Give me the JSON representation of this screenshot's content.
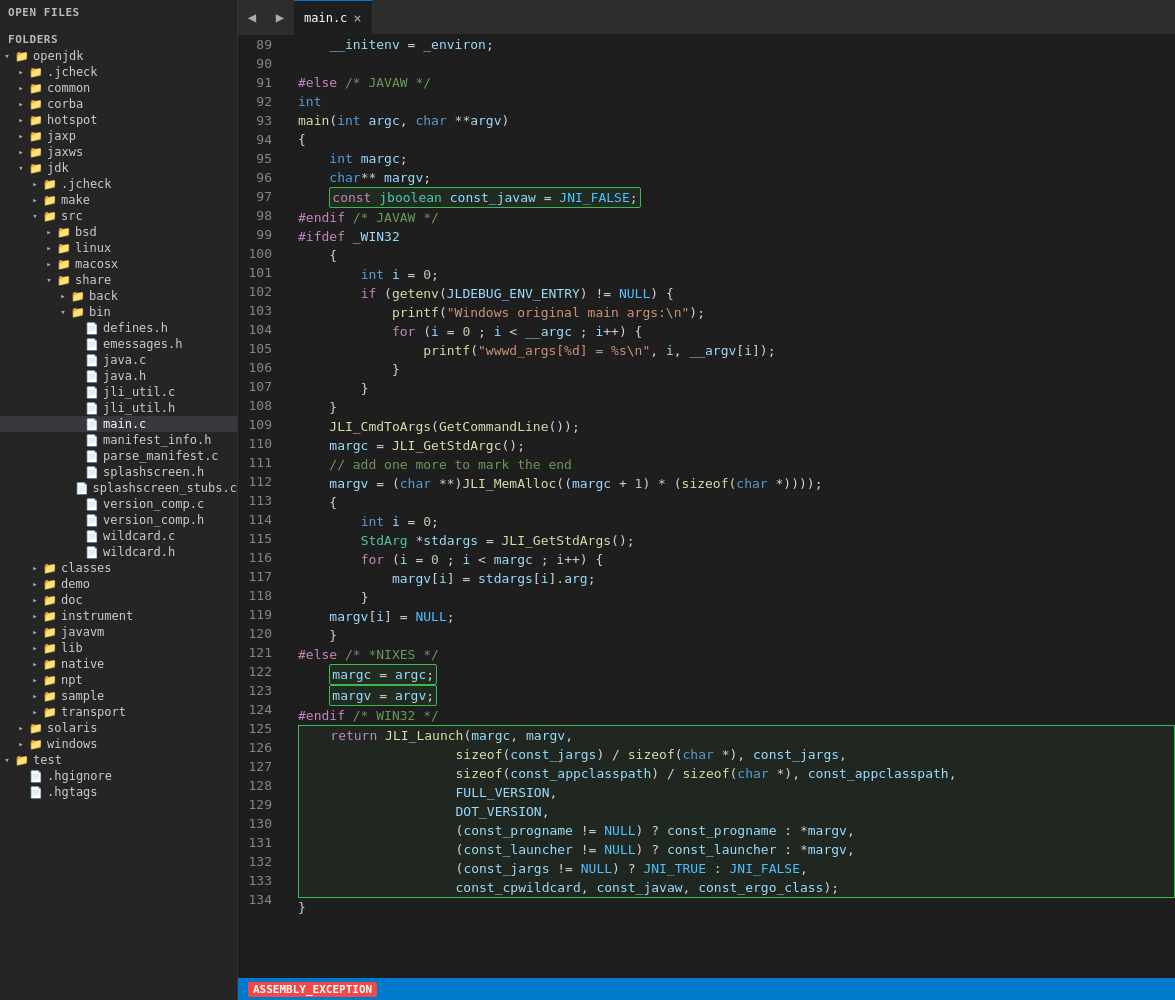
{
  "sidebar": {
    "open_files_label": "OPEN FILES",
    "folders_label": "FOLDERS",
    "tree": [
      {
        "id": "openjdk",
        "label": "openjdk",
        "type": "folder",
        "expanded": true,
        "depth": 0
      },
      {
        "id": "jcheck",
        "label": ".jcheck",
        "type": "folder",
        "expanded": false,
        "depth": 1
      },
      {
        "id": "common",
        "label": "common",
        "type": "folder",
        "expanded": false,
        "depth": 1
      },
      {
        "id": "corba",
        "label": "corba",
        "type": "folder",
        "expanded": false,
        "depth": 1
      },
      {
        "id": "hotspot",
        "label": "hotspot",
        "type": "folder",
        "expanded": false,
        "depth": 1
      },
      {
        "id": "jaxp",
        "label": "jaxp",
        "type": "folder",
        "expanded": false,
        "depth": 1
      },
      {
        "id": "jaxws",
        "label": "jaxws",
        "type": "folder",
        "expanded": false,
        "depth": 1
      },
      {
        "id": "jdk",
        "label": "jdk",
        "type": "folder",
        "expanded": true,
        "depth": 1
      },
      {
        "id": "jdk-jcheck",
        "label": ".jcheck",
        "type": "folder",
        "expanded": false,
        "depth": 2
      },
      {
        "id": "make",
        "label": "make",
        "type": "folder",
        "expanded": false,
        "depth": 2
      },
      {
        "id": "src",
        "label": "src",
        "type": "folder",
        "expanded": true,
        "depth": 2
      },
      {
        "id": "bsd",
        "label": "bsd",
        "type": "folder",
        "expanded": false,
        "depth": 3
      },
      {
        "id": "linux",
        "label": "linux",
        "type": "folder",
        "expanded": false,
        "depth": 3
      },
      {
        "id": "macosx",
        "label": "macosx",
        "type": "folder",
        "expanded": false,
        "depth": 3
      },
      {
        "id": "share",
        "label": "share",
        "type": "folder",
        "expanded": true,
        "depth": 3
      },
      {
        "id": "back",
        "label": "back",
        "type": "folder",
        "expanded": false,
        "depth": 4
      },
      {
        "id": "bin",
        "label": "bin",
        "type": "folder",
        "expanded": true,
        "depth": 4
      },
      {
        "id": "defines-h",
        "label": "defines.h",
        "type": "file-h",
        "depth": 5
      },
      {
        "id": "emessages-h",
        "label": "emessages.h",
        "type": "file-h",
        "depth": 5
      },
      {
        "id": "java-c",
        "label": "java.c",
        "type": "file-c",
        "depth": 5
      },
      {
        "id": "java-h",
        "label": "java.h",
        "type": "file-h",
        "depth": 5
      },
      {
        "id": "jli_util-c",
        "label": "jli_util.c",
        "type": "file-c",
        "depth": 5
      },
      {
        "id": "jli_util-h",
        "label": "jli_util.h",
        "type": "file-h",
        "depth": 5
      },
      {
        "id": "main-c",
        "label": "main.c",
        "type": "file-c",
        "depth": 5,
        "active": true
      },
      {
        "id": "manifest_info-h",
        "label": "manifest_info.h",
        "type": "file-h",
        "depth": 5
      },
      {
        "id": "parse_manifest-c",
        "label": "parse_manifest.c",
        "type": "file-c",
        "depth": 5
      },
      {
        "id": "splashscreen-h",
        "label": "splashscreen.h",
        "type": "file-h",
        "depth": 5
      },
      {
        "id": "splashscreen_stubs-c",
        "label": "splashscreen_stubs.c",
        "type": "file-c",
        "depth": 5
      },
      {
        "id": "version_comp-c",
        "label": "version_comp.c",
        "type": "file-c",
        "depth": 5
      },
      {
        "id": "version_comp-h",
        "label": "version_comp.h",
        "type": "file-h",
        "depth": 5
      },
      {
        "id": "wildcard-c",
        "label": "wildcard.c",
        "type": "file-c",
        "depth": 5
      },
      {
        "id": "wildcard-h",
        "label": "wildcard.h",
        "type": "file-h",
        "depth": 5
      },
      {
        "id": "classes",
        "label": "classes",
        "type": "folder",
        "expanded": false,
        "depth": 2
      },
      {
        "id": "demo",
        "label": "demo",
        "type": "folder",
        "expanded": false,
        "depth": 2
      },
      {
        "id": "doc",
        "label": "doc",
        "type": "folder",
        "expanded": false,
        "depth": 2
      },
      {
        "id": "instrument",
        "label": "instrument",
        "type": "folder",
        "expanded": false,
        "depth": 2
      },
      {
        "id": "javavm",
        "label": "javavm",
        "type": "folder",
        "expanded": false,
        "depth": 2
      },
      {
        "id": "lib",
        "label": "lib",
        "type": "folder",
        "expanded": false,
        "depth": 2
      },
      {
        "id": "native",
        "label": "native",
        "type": "folder",
        "expanded": false,
        "depth": 2
      },
      {
        "id": "npt",
        "label": "npt",
        "type": "folder",
        "expanded": false,
        "depth": 2
      },
      {
        "id": "sample",
        "label": "sample",
        "type": "folder",
        "expanded": false,
        "depth": 2
      },
      {
        "id": "transport",
        "label": "transport",
        "type": "folder",
        "expanded": false,
        "depth": 2
      },
      {
        "id": "solaris",
        "label": "solaris",
        "type": "folder",
        "expanded": false,
        "depth": 1
      },
      {
        "id": "windows",
        "label": "windows",
        "type": "folder",
        "expanded": false,
        "depth": 1
      },
      {
        "id": "test",
        "label": "test",
        "type": "folder",
        "expanded": true,
        "depth": 0
      },
      {
        "id": "hgignore",
        "label": ".hgignore",
        "type": "file-c",
        "depth": 1
      },
      {
        "id": "hgtags",
        "label": ".hgtags",
        "type": "file-c",
        "depth": 1
      }
    ]
  },
  "tab": {
    "filename": "main.c",
    "close_symbol": "×"
  },
  "nav": {
    "prev": "◀",
    "next": "▶"
  },
  "status": {
    "assembly_label": "ASSEMBLY_EXCEPTION"
  },
  "code": {
    "lines": [
      {
        "n": 89,
        "text": "    __initenv = _environ;"
      },
      {
        "n": 90,
        "text": ""
      },
      {
        "n": 91,
        "text": "#else /* JAVAW */"
      },
      {
        "n": 92,
        "text": "int"
      },
      {
        "n": 93,
        "text": "main(int argc, char **argv)"
      },
      {
        "n": 94,
        "text": "{"
      },
      {
        "n": 95,
        "text": "    int margc;"
      },
      {
        "n": 96,
        "text": "    char** margv;"
      },
      {
        "n": 97,
        "text": "    const jboolean const_javaw = JNI_FALSE;"
      },
      {
        "n": 98,
        "text": "#endif /* JAVAW */"
      },
      {
        "n": 99,
        "text": "#ifdef _WIN32"
      },
      {
        "n": 100,
        "text": "    {"
      },
      {
        "n": 101,
        "text": "        int i = 0;"
      },
      {
        "n": 102,
        "text": "        if (getenv(JLDEBUG_ENV_ENTRY) != NULL) {"
      },
      {
        "n": 103,
        "text": "            printf(\"Windows original main args:\\n\");"
      },
      {
        "n": 104,
        "text": "            for (i = 0 ; i < __argc ; i++) {"
      },
      {
        "n": 105,
        "text": "                printf(\"wwwd_args[%d] = %s\\n\", i, __argv[i]);"
      },
      {
        "n": 106,
        "text": "            }"
      },
      {
        "n": 107,
        "text": "        }"
      },
      {
        "n": 108,
        "text": "    }"
      },
      {
        "n": 109,
        "text": "    JLI_CmdToArgs(GetCommandLine());"
      },
      {
        "n": 110,
        "text": "    margc = JLI_GetStdArgc();"
      },
      {
        "n": 111,
        "text": "    // add one more to mark the end"
      },
      {
        "n": 112,
        "text": "    margv = (char **)JLI_MemAlloc((margc + 1) * (sizeof(char *)));"
      },
      {
        "n": 113,
        "text": "    {"
      },
      {
        "n": 114,
        "text": "        int i = 0;"
      },
      {
        "n": 115,
        "text": "        StdArg *stdargs = JLI_GetStdArgs();"
      },
      {
        "n": 116,
        "text": "        for (i = 0 ; i < margc ; i++) {"
      },
      {
        "n": 117,
        "text": "            margv[i] = stdargs[i].arg;"
      },
      {
        "n": 118,
        "text": "        }"
      },
      {
        "n": 119,
        "text": "    margv[i] = NULL;"
      },
      {
        "n": 120,
        "text": "    }"
      },
      {
        "n": 121,
        "text": "#else /* *NIXES */"
      },
      {
        "n": 122,
        "text": "    margc = argc;"
      },
      {
        "n": 123,
        "text": "    margv = argv;"
      },
      {
        "n": 124,
        "text": "#endif /* WIN32 */"
      },
      {
        "n": 125,
        "text": "    return JLI_Launch(margc, margv,"
      },
      {
        "n": 126,
        "text": "                    sizeof(const_jargs) / sizeof(char *), const_jargs,"
      },
      {
        "n": 127,
        "text": "                    sizeof(const_appclasspath) / sizeof(char *), const_appclasspath,"
      },
      {
        "n": 128,
        "text": "                    FULL_VERSION,"
      },
      {
        "n": 129,
        "text": "                    DOT_VERSION,"
      },
      {
        "n": 130,
        "text": "                    (const_progname != NULL) ? const_progname : *margv,"
      },
      {
        "n": 131,
        "text": "                    (const_launcher != NULL) ? const_launcher : *margv,"
      },
      {
        "n": 132,
        "text": "                    (const_jargs != NULL) ? JNI_TRUE : JNI_FALSE,"
      },
      {
        "n": 133,
        "text": "                    const_cpwildcard, const_javaw, const_ergo_class);"
      },
      {
        "n": 134,
        "text": "}"
      }
    ]
  }
}
